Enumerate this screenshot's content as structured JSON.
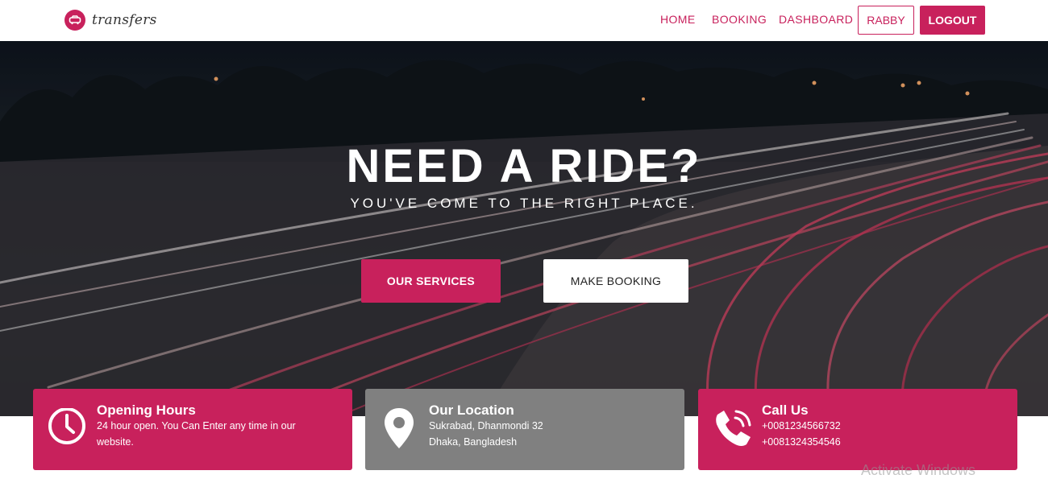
{
  "brand": {
    "name": "transfers",
    "accent": "#c8215c"
  },
  "nav": {
    "home": "HOME",
    "booking": "BOOKING",
    "dashboard": "DASHBOARD",
    "user": "RABBY",
    "logout": "LOGOUT"
  },
  "hero": {
    "title": "NEED A RIDE?",
    "subtitle": "YOU'VE COME TO THE RIGHT PLACE.",
    "services_button": "OUR SERVICES",
    "booking_button": "MAKE BOOKING"
  },
  "cards": [
    {
      "title": "Opening Hours",
      "line1": "24 hour open. You Can Enter any time in our",
      "line2": "website.",
      "icon": "clock-icon",
      "color": "#c8215c"
    },
    {
      "title": "Our Location",
      "line1": "Sukrabad, Dhanmondi 32",
      "line2": "Dhaka, Bangladesh",
      "icon": "location-pin-icon",
      "color": "#808080"
    },
    {
      "title": "Call Us",
      "line1": "+0081234566732",
      "line2": "+0081324354546",
      "icon": "phone-icon",
      "color": "#c8215c"
    }
  ],
  "watermark": "Activate Windows"
}
